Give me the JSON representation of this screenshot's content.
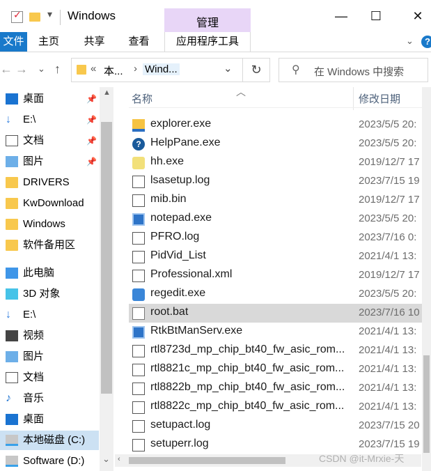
{
  "window": {
    "title": "Windows",
    "context_tab": "管理",
    "controls": {
      "minimize": "—",
      "maximize": "☐",
      "close": "✕"
    }
  },
  "ribbon": {
    "tabs": [
      "文件",
      "主页",
      "共享",
      "查看",
      "应用程序工具"
    ],
    "help": "?"
  },
  "address": {
    "overflow": "«",
    "crumbs": [
      "本...",
      "Wind..."
    ],
    "chevron": "›",
    "search_placeholder": "在 Windows 中搜索"
  },
  "nav_pane": {
    "items": [
      {
        "label": "桌面",
        "icon": "desktop-icon",
        "pinned": true
      },
      {
        "label": "E:\\",
        "icon": "download-icon",
        "pinned": true
      },
      {
        "label": "文档",
        "icon": "document-icon",
        "pinned": true
      },
      {
        "label": "图片",
        "icon": "image-icon",
        "pinned": true
      },
      {
        "label": "DRIVERS",
        "icon": "folder-icon",
        "pinned": false
      },
      {
        "label": "KwDownload",
        "icon": "folder-icon",
        "pinned": false
      },
      {
        "label": "Windows",
        "icon": "folder-icon",
        "pinned": false
      },
      {
        "label": "软件备用区",
        "icon": "folder-icon",
        "pinned": false
      },
      {
        "label": "此电脑",
        "icon": "pc-icon",
        "pinned": false
      },
      {
        "label": "3D 对象",
        "icon": "cube-icon",
        "pinned": false
      },
      {
        "label": "E:\\",
        "icon": "download-icon",
        "pinned": false
      },
      {
        "label": "视频",
        "icon": "video-icon",
        "pinned": false
      },
      {
        "label": "图片",
        "icon": "image-icon",
        "pinned": false
      },
      {
        "label": "文档",
        "icon": "document-icon",
        "pinned": false
      },
      {
        "label": "音乐",
        "icon": "music-icon",
        "pinned": false
      },
      {
        "label": "桌面",
        "icon": "desktop-icon",
        "pinned": false
      },
      {
        "label": "本地磁盘 (C:)",
        "icon": "drive-icon",
        "pinned": false,
        "selected": true
      },
      {
        "label": "Software (D:)",
        "icon": "drive-icon",
        "pinned": false
      }
    ]
  },
  "file_list": {
    "columns": {
      "name": "名称",
      "modified": "修改日期"
    },
    "rows": [
      {
        "name": "explorer.exe",
        "modified": "2023/5/5 20:",
        "icon": "explorer-icon"
      },
      {
        "name": "HelpPane.exe",
        "modified": "2023/5/5 20:",
        "icon": "help-icon"
      },
      {
        "name": "hh.exe",
        "modified": "2019/12/7 17",
        "icon": "chm-icon"
      },
      {
        "name": "lsasetup.log",
        "modified": "2023/7/15 19",
        "icon": "text-file-icon"
      },
      {
        "name": "mib.bin",
        "modified": "2019/12/7 17",
        "icon": "file-icon"
      },
      {
        "name": "notepad.exe",
        "modified": "2023/5/5 20:",
        "icon": "app-icon"
      },
      {
        "name": "PFRO.log",
        "modified": "2023/7/16 0:",
        "icon": "text-file-icon"
      },
      {
        "name": "PidVid_List",
        "modified": "2021/4/1 13:",
        "icon": "file-icon"
      },
      {
        "name": "Professional.xml",
        "modified": "2019/12/7 17",
        "icon": "file-icon"
      },
      {
        "name": "regedit.exe",
        "modified": "2023/5/5 20:",
        "icon": "regedit-icon"
      },
      {
        "name": "root.bat",
        "modified": "2023/7/16 10",
        "icon": "bat-icon",
        "selected": true
      },
      {
        "name": "RtkBtManServ.exe",
        "modified": "2021/4/1 13:",
        "icon": "app-icon"
      },
      {
        "name": "rtl8723d_mp_chip_bt40_fw_asic_rom...",
        "modified": "2021/4/1 13:",
        "icon": "file-icon"
      },
      {
        "name": "rtl8821c_mp_chip_bt40_fw_asic_rom...",
        "modified": "2021/4/1 13:",
        "icon": "file-icon"
      },
      {
        "name": "rtl8822b_mp_chip_bt40_fw_asic_rom...",
        "modified": "2021/4/1 13:",
        "icon": "file-icon"
      },
      {
        "name": "rtl8822c_mp_chip_bt40_fw_asic_rom...",
        "modified": "2021/4/1 13:",
        "icon": "file-icon"
      },
      {
        "name": "setupact.log",
        "modified": "2023/7/15 20",
        "icon": "text-file-icon"
      },
      {
        "name": "setuperr.log",
        "modified": "2023/7/15 19",
        "icon": "text-file-icon"
      }
    ]
  },
  "watermark": "CSDN @it-Mrxie-天",
  "colors": {
    "accent": "#1979ca",
    "context_tab": "#e8d6f7",
    "selected_row": "#d9d9d9",
    "nav_selected": "#cce1f3"
  }
}
